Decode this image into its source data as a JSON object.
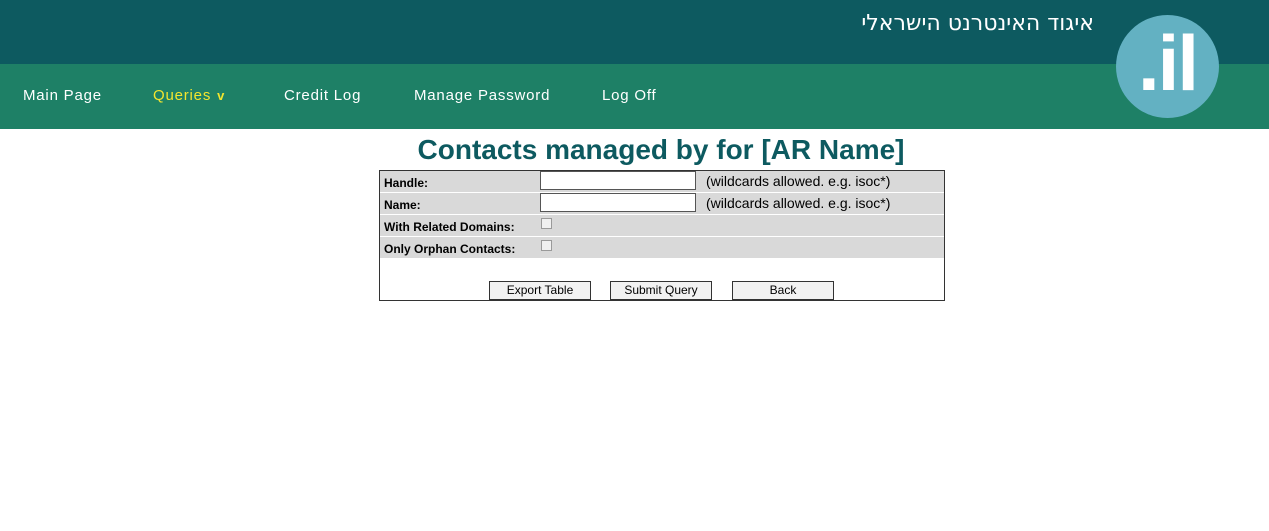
{
  "header": {
    "org_name": "איגוד האינטרנט הישראלי",
    "logo_text": ".il",
    "colors": {
      "top": "#0d5a60",
      "nav": "#1e8066",
      "active": "#f2e52e",
      "logo": "#63b1c2"
    }
  },
  "nav": {
    "items": [
      {
        "label": "Main Page"
      },
      {
        "label": "Queries",
        "caret": "v",
        "active": true
      },
      {
        "label": "Credit Log"
      },
      {
        "label": "Manage Password"
      },
      {
        "label": "Log Off"
      }
    ]
  },
  "main": {
    "title": "Contacts managed by for [AR Name]",
    "fields": [
      {
        "label": "Handle:",
        "value": "",
        "hint": "(wildcards allowed. e.g. isoc*)"
      },
      {
        "label": "Name:",
        "value": "",
        "hint": "(wildcards allowed. e.g. isoc*)"
      },
      {
        "label": "With Related Domains:",
        "checked": false
      },
      {
        "label": "Only Orphan Contacts:",
        "checked": false
      }
    ],
    "buttons": {
      "export": "Export Table",
      "submit": "Submit Query",
      "back": "Back"
    }
  }
}
